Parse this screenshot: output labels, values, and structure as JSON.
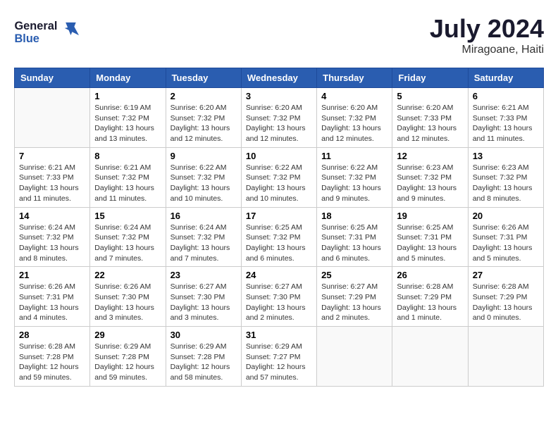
{
  "header": {
    "logo_general": "General",
    "logo_blue": "Blue",
    "month": "July 2024",
    "location": "Miragoane, Haiti"
  },
  "days_of_week": [
    "Sunday",
    "Monday",
    "Tuesday",
    "Wednesday",
    "Thursday",
    "Friday",
    "Saturday"
  ],
  "weeks": [
    [
      {
        "day": "",
        "info": ""
      },
      {
        "day": "1",
        "info": "Sunrise: 6:19 AM\nSunset: 7:32 PM\nDaylight: 13 hours\nand 13 minutes."
      },
      {
        "day": "2",
        "info": "Sunrise: 6:20 AM\nSunset: 7:32 PM\nDaylight: 13 hours\nand 12 minutes."
      },
      {
        "day": "3",
        "info": "Sunrise: 6:20 AM\nSunset: 7:32 PM\nDaylight: 13 hours\nand 12 minutes."
      },
      {
        "day": "4",
        "info": "Sunrise: 6:20 AM\nSunset: 7:32 PM\nDaylight: 13 hours\nand 12 minutes."
      },
      {
        "day": "5",
        "info": "Sunrise: 6:20 AM\nSunset: 7:33 PM\nDaylight: 13 hours\nand 12 minutes."
      },
      {
        "day": "6",
        "info": "Sunrise: 6:21 AM\nSunset: 7:33 PM\nDaylight: 13 hours\nand 11 minutes."
      }
    ],
    [
      {
        "day": "7",
        "info": "Sunrise: 6:21 AM\nSunset: 7:33 PM\nDaylight: 13 hours\nand 11 minutes."
      },
      {
        "day": "8",
        "info": "Sunrise: 6:21 AM\nSunset: 7:32 PM\nDaylight: 13 hours\nand 11 minutes."
      },
      {
        "day": "9",
        "info": "Sunrise: 6:22 AM\nSunset: 7:32 PM\nDaylight: 13 hours\nand 10 minutes."
      },
      {
        "day": "10",
        "info": "Sunrise: 6:22 AM\nSunset: 7:32 PM\nDaylight: 13 hours\nand 10 minutes."
      },
      {
        "day": "11",
        "info": "Sunrise: 6:22 AM\nSunset: 7:32 PM\nDaylight: 13 hours\nand 9 minutes."
      },
      {
        "day": "12",
        "info": "Sunrise: 6:23 AM\nSunset: 7:32 PM\nDaylight: 13 hours\nand 9 minutes."
      },
      {
        "day": "13",
        "info": "Sunrise: 6:23 AM\nSunset: 7:32 PM\nDaylight: 13 hours\nand 8 minutes."
      }
    ],
    [
      {
        "day": "14",
        "info": "Sunrise: 6:24 AM\nSunset: 7:32 PM\nDaylight: 13 hours\nand 8 minutes."
      },
      {
        "day": "15",
        "info": "Sunrise: 6:24 AM\nSunset: 7:32 PM\nDaylight: 13 hours\nand 7 minutes."
      },
      {
        "day": "16",
        "info": "Sunrise: 6:24 AM\nSunset: 7:32 PM\nDaylight: 13 hours\nand 7 minutes."
      },
      {
        "day": "17",
        "info": "Sunrise: 6:25 AM\nSunset: 7:32 PM\nDaylight: 13 hours\nand 6 minutes."
      },
      {
        "day": "18",
        "info": "Sunrise: 6:25 AM\nSunset: 7:31 PM\nDaylight: 13 hours\nand 6 minutes."
      },
      {
        "day": "19",
        "info": "Sunrise: 6:25 AM\nSunset: 7:31 PM\nDaylight: 13 hours\nand 5 minutes."
      },
      {
        "day": "20",
        "info": "Sunrise: 6:26 AM\nSunset: 7:31 PM\nDaylight: 13 hours\nand 5 minutes."
      }
    ],
    [
      {
        "day": "21",
        "info": "Sunrise: 6:26 AM\nSunset: 7:31 PM\nDaylight: 13 hours\nand 4 minutes."
      },
      {
        "day": "22",
        "info": "Sunrise: 6:26 AM\nSunset: 7:30 PM\nDaylight: 13 hours\nand 3 minutes."
      },
      {
        "day": "23",
        "info": "Sunrise: 6:27 AM\nSunset: 7:30 PM\nDaylight: 13 hours\nand 3 minutes."
      },
      {
        "day": "24",
        "info": "Sunrise: 6:27 AM\nSunset: 7:30 PM\nDaylight: 13 hours\nand 2 minutes."
      },
      {
        "day": "25",
        "info": "Sunrise: 6:27 AM\nSunset: 7:29 PM\nDaylight: 13 hours\nand 2 minutes."
      },
      {
        "day": "26",
        "info": "Sunrise: 6:28 AM\nSunset: 7:29 PM\nDaylight: 13 hours\nand 1 minute."
      },
      {
        "day": "27",
        "info": "Sunrise: 6:28 AM\nSunset: 7:29 PM\nDaylight: 13 hours\nand 0 minutes."
      }
    ],
    [
      {
        "day": "28",
        "info": "Sunrise: 6:28 AM\nSunset: 7:28 PM\nDaylight: 12 hours\nand 59 minutes."
      },
      {
        "day": "29",
        "info": "Sunrise: 6:29 AM\nSunset: 7:28 PM\nDaylight: 12 hours\nand 59 minutes."
      },
      {
        "day": "30",
        "info": "Sunrise: 6:29 AM\nSunset: 7:28 PM\nDaylight: 12 hours\nand 58 minutes."
      },
      {
        "day": "31",
        "info": "Sunrise: 6:29 AM\nSunset: 7:27 PM\nDaylight: 12 hours\nand 57 minutes."
      },
      {
        "day": "",
        "info": ""
      },
      {
        "day": "",
        "info": ""
      },
      {
        "day": "",
        "info": ""
      }
    ]
  ]
}
